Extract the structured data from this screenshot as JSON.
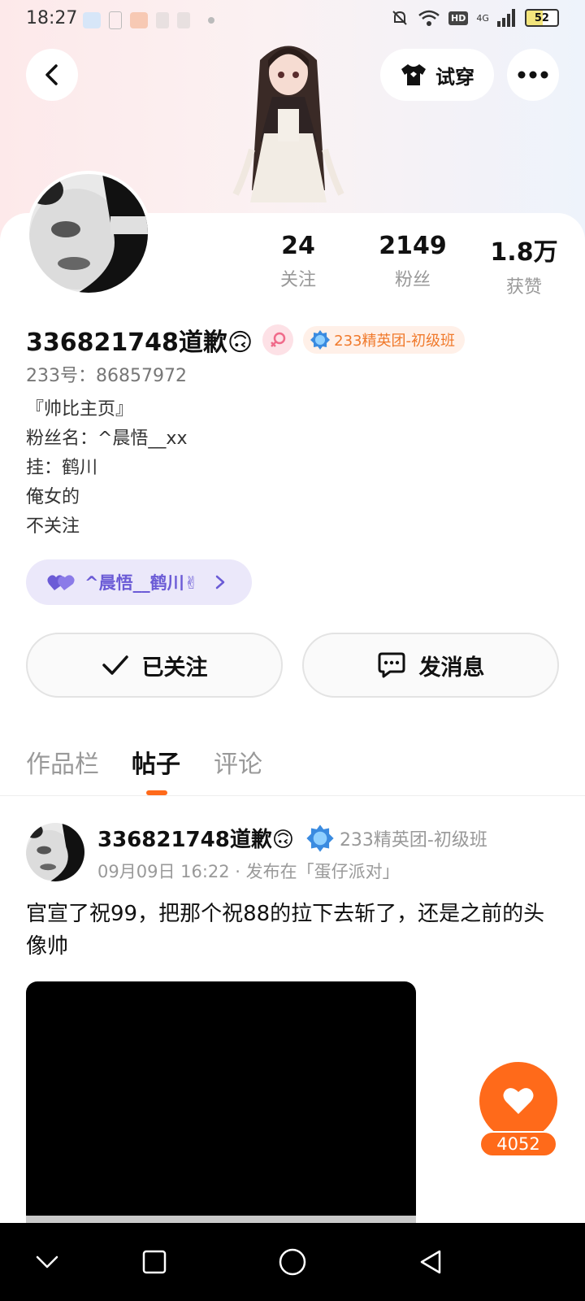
{
  "status_bar": {
    "time": "18:27",
    "battery": "52",
    "network": "4G",
    "hd": "HD"
  },
  "header": {
    "back_icon": "chevron-left-icon",
    "try_on_label": "试穿",
    "try_on_icon": "shirt-icon",
    "more_icon": "more-dots-icon"
  },
  "profile": {
    "stats": [
      {
        "value": "24",
        "label": "关注"
      },
      {
        "value": "2149",
        "label": "粉丝"
      },
      {
        "value": "1.8万",
        "label": "获赞"
      }
    ],
    "name": "336821748道歉🙃",
    "gender_icon": "female-symbol-icon",
    "badge_label": "233精英团-初级班",
    "id_label": "233号：86857972",
    "bio_lines": [
      "『帅比主页』",
      "粉丝名：^晨悟__xx",
      "挂：鹤川",
      "俺女的",
      "不关注"
    ],
    "cp_label": "^晨悟__鹤川✌",
    "followed_label": "已关注",
    "message_label": "发消息"
  },
  "tabs": [
    {
      "label": "作品栏",
      "active": false
    },
    {
      "label": "帖子",
      "active": true
    },
    {
      "label": "评论",
      "active": false
    }
  ],
  "post": {
    "author": "336821748道歉🙃",
    "badge_label": "233精英团-初级班",
    "meta": "09月09日 16:22 · 发布在「蛋仔派对」",
    "text": "官宣了祝99，把那个祝88的拉下去斩了，还是之前的头像帅"
  },
  "like": {
    "count": "4052"
  },
  "colors": {
    "accent": "#ff6a1a",
    "cp_pill_bg": "#ebe8fa",
    "cp_text": "#6b5bd6",
    "badge_bg": "#fff0e8",
    "badge_text": "#f07a2c"
  }
}
